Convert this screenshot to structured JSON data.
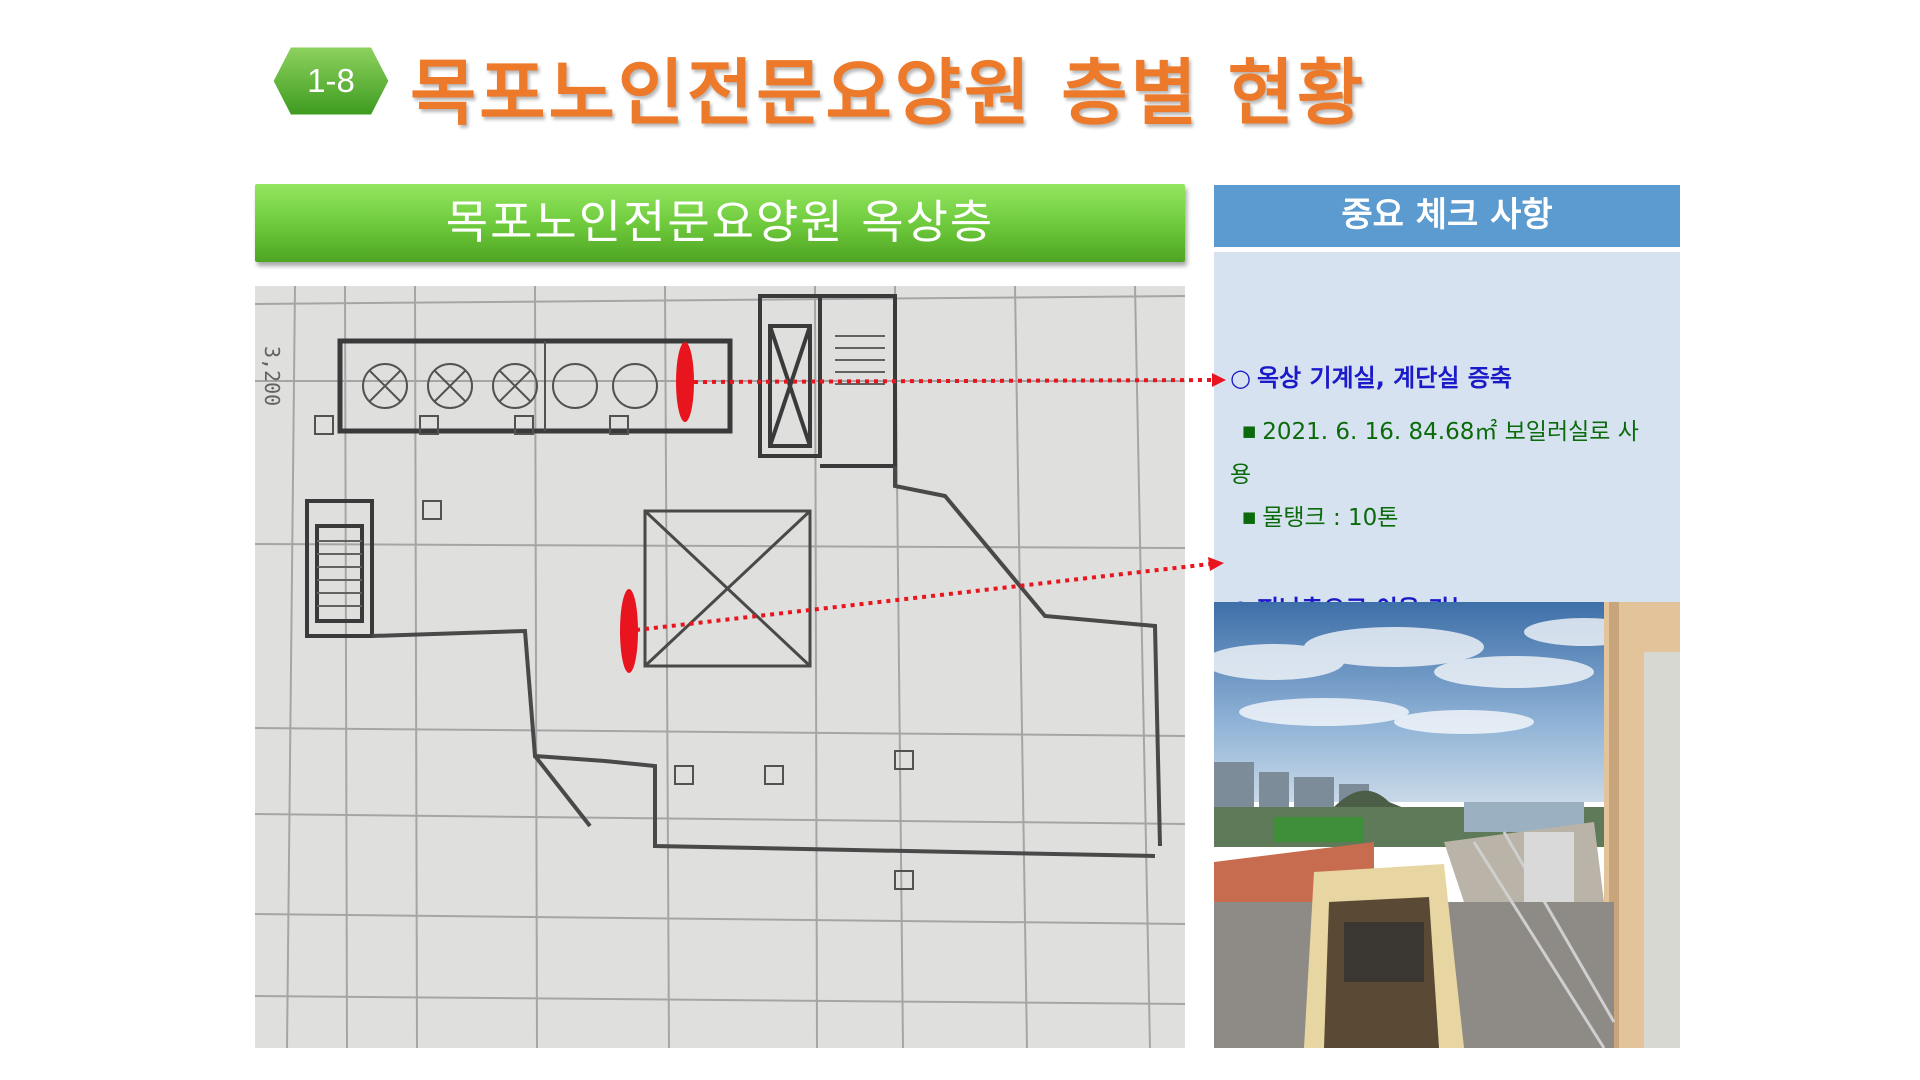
{
  "badge": {
    "label": "1-8"
  },
  "title": "목포노인전문요양원 층별 현황",
  "floor_banner": "목포노인전문요양원 옥상층",
  "plan": {
    "dimension_label": "3,200"
  },
  "check": {
    "header": "중요 체크 사항",
    "items": [
      {
        "bullet": "○",
        "heading": "옥상 기계실, 계단실 증축",
        "lines": [
          {
            "marker": "■",
            "text": "2021. 6. 16. 84.68㎡ 보일러실로 사",
            "wrap": "용"
          },
          {
            "marker": "■",
            "text": "물탱크 : 10톤"
          }
        ]
      },
      {
        "bullet": "○",
        "heading": "피난층으로 이용 가능"
      }
    ]
  },
  "colors": {
    "title": "#ec7a2a",
    "badge_green": "#5db33a",
    "banner_green": "#6cc83a",
    "check_header": "#5b9bcf",
    "check_body": "#d6e2f0",
    "heading_blue": "#1a1ac8",
    "text_green": "#0b6b0b",
    "marker_red": "#e8141e"
  }
}
